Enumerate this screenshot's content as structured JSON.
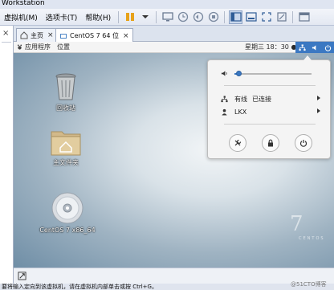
{
  "app": {
    "title_fragment": "Workstation"
  },
  "menubar": {
    "items": [
      "虚拟机(M)",
      "选项卡(T)",
      "帮助(H)"
    ]
  },
  "toolbar": {
    "icons": [
      "pause-icon",
      "snapshot-icon",
      "snapshot-revert-icon",
      "snapshot-manager-icon",
      "full-screen-icon",
      "unity-icon",
      "console-view-icon",
      "stretch-icon",
      "library-view-icon"
    ]
  },
  "tabs": [
    {
      "label": "主页",
      "icon": "home-icon",
      "close": "×"
    },
    {
      "label": "CentOS 7 64 位",
      "icon": "vm-icon",
      "close": "×"
    }
  ],
  "library": {
    "close_label": "×"
  },
  "guest": {
    "topbar": {
      "apps_label": "应用程序",
      "places_label": "位置",
      "clock": "星期三 18：30 ●"
    },
    "desktop_icons": [
      {
        "label": "回收站",
        "icon": "trash-icon"
      },
      {
        "label": "主文件夹",
        "icon": "home-folder-icon"
      },
      {
        "label": "CentOS 7 x86_64",
        "icon": "disc-icon"
      }
    ],
    "wallpaper": {
      "mark": "7",
      "word": "CENTOS"
    },
    "system_menu": {
      "volume": 0.05,
      "wired_label": "有线",
      "wired_status": "已连接",
      "user_label": "LKX",
      "buttons": [
        "settings-icon",
        "lock-icon",
        "power-icon"
      ]
    }
  },
  "bottom": {
    "hint": "要将输入定向到该虚拟机，请在虚拟机内部单击或按 Ctrl+G。",
    "watermark": "@51CTO博客"
  },
  "colors": {
    "accent": "#3b78c2",
    "menu_bg": "#f4f4f4"
  }
}
